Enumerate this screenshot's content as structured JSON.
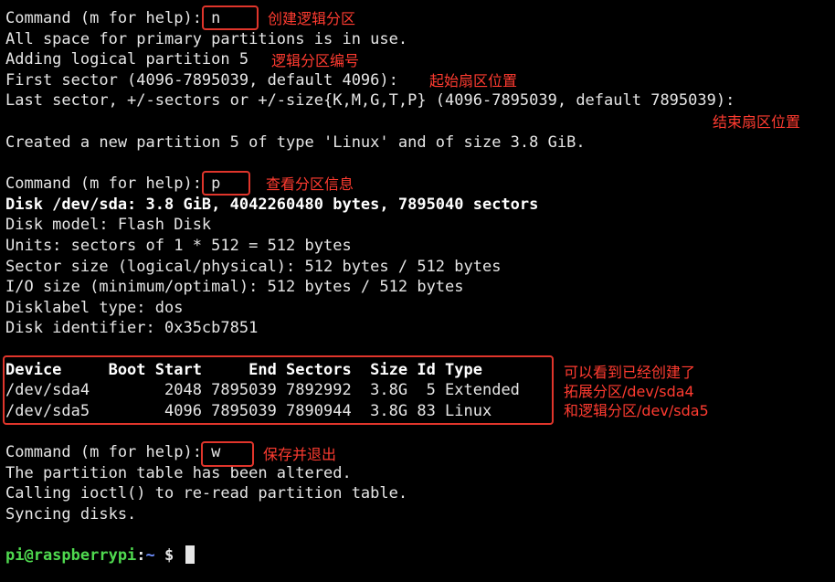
{
  "colors": {
    "background": "#000000",
    "text": "#e6e6e6",
    "annotation": "#ff3b30",
    "prompt_user": "#4fd94f",
    "prompt_path": "#6f8fff"
  },
  "lines": [
    "Command (m for help): n",
    "All space for primary partitions is in use.",
    "Adding logical partition 5",
    "First sector (4096-7895039, default 4096):",
    "Last sector, +/-sectors or +/-size{K,M,G,T,P} (4096-7895039, default 7895039):",
    "Created a new partition 5 of type 'Linux' and of size 3.8 GiB.",
    "Command (m for help): p",
    "Disk /dev/sda: 3.8 GiB, 4042260480 bytes, 7895040 sectors",
    "Disk model: Flash Disk",
    "Units: sectors of 1 * 512 = 512 bytes",
    "Sector size (logical/physical): 512 bytes / 512 bytes",
    "I/O size (minimum/optimal): 512 bytes / 512 bytes",
    "Disklabel type: dos",
    "Disk identifier: 0x35cb7851",
    "Device     Boot Start     End Sectors  Size Id Type",
    "/dev/sda4        2048 7895039 7892992  3.8G  5 Extended",
    "/dev/sda5        4096 7895039 7890944  3.8G 83 Linux",
    "Command (m for help): w",
    "The partition table has been altered.",
    "Calling ioctl() to re-read partition table.",
    "Syncing disks."
  ],
  "prompt": {
    "user_host": "pi@raspberrypi",
    "colon": ":",
    "path": "~",
    "symbol": " $ "
  },
  "annotations": {
    "create_logical": "创建逻辑分区",
    "logical_number": "逻辑分区编号",
    "start_sector": "起始扇区位置",
    "end_sector": "结束扇区位置",
    "view_info": "查看分区信息",
    "table_note_1": "可以看到已经创建了",
    "table_note_2": "拓展分区/dev/sda4",
    "table_note_3": "和逻辑分区/dev/sda5",
    "save_exit": "保存并退出"
  }
}
